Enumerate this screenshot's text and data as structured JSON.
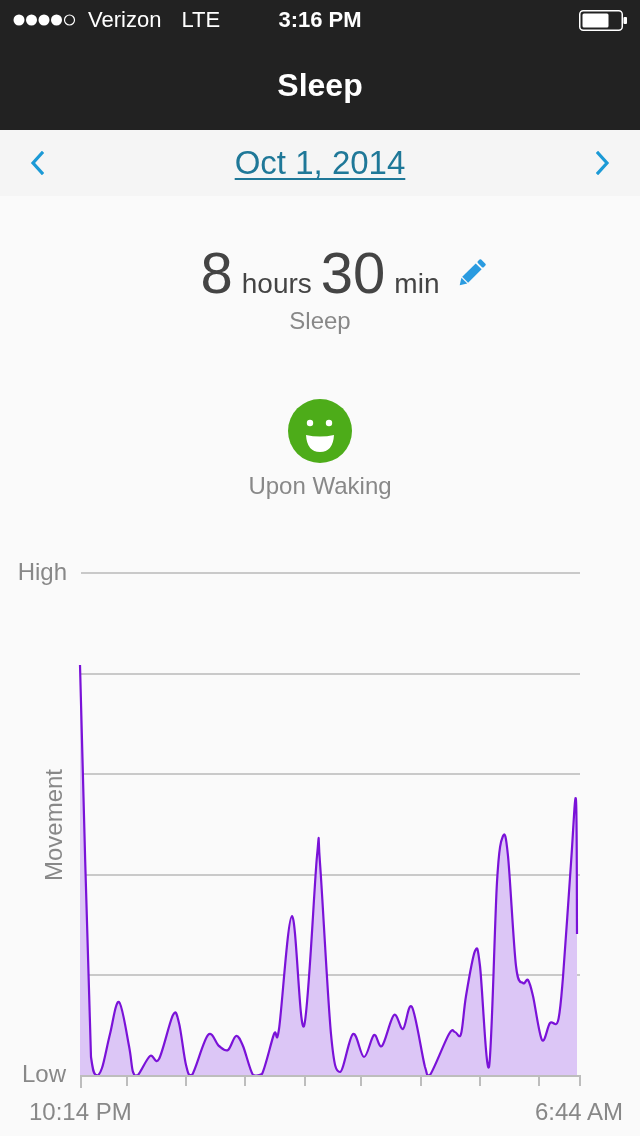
{
  "status_bar": {
    "carrier": "Verizon",
    "network": "LTE",
    "time": "3:16 PM"
  },
  "nav_bar": {
    "title": "Sleep"
  },
  "date_bar": {
    "date": "Oct 1, 2014"
  },
  "summary": {
    "hours": "8",
    "hours_unit": "hours",
    "minutes": "30",
    "minutes_unit": "min",
    "label": "Sleep"
  },
  "wake_mood": {
    "kind": "happy",
    "label": "Upon Waking"
  },
  "movement_chart": {
    "ylabel": "Movement",
    "y_top_label": "High",
    "y_bottom_label": "Low",
    "x_start_label": "10:14 PM",
    "x_end_label": "6:44 AM"
  }
}
